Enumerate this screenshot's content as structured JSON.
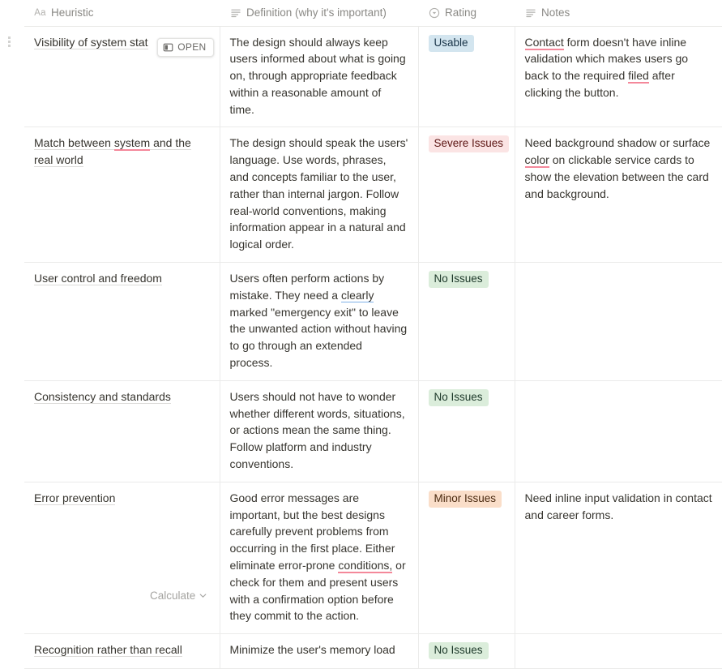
{
  "table": {
    "columns": [
      {
        "id": "heuristic",
        "label": "Heuristic",
        "icon": "title-aa-icon",
        "icon_text": "Aa"
      },
      {
        "id": "definition",
        "label": "Definition (why it's important)",
        "icon": "text-lines-icon",
        "icon_text": ""
      },
      {
        "id": "rating",
        "label": "Rating",
        "icon": "select-circle-chevron-icon",
        "icon_text": ""
      },
      {
        "id": "notes",
        "label": "Notes",
        "icon": "text-lines-icon",
        "icon_text": ""
      }
    ],
    "row_open_button": {
      "label": "OPEN",
      "icon": "expand-panel-icon"
    },
    "footer": {
      "calculate_label": "Calculate",
      "chevron_icon": "chevron-down-icon"
    },
    "colors": {
      "pill_usable_bg": "#d3e5ef",
      "pill_usable_text": "#183347",
      "pill_severe_bg": "#fbe4e4",
      "pill_severe_text": "#5d1715",
      "pill_none_bg": "#dbeddb",
      "pill_none_text": "#1c3829",
      "pill_minor_bg": "#fadec9",
      "pill_minor_text": "#49290f",
      "spellcheck_underline": "#f4889a",
      "grammar_underline": "#7fb0e8",
      "grid_line": "#ebebea",
      "header_text": "#8a8985"
    },
    "rows": [
      {
        "heuristic": "Visibility of system status",
        "heuristic_truncated": "Visibility of system stat",
        "definition": "The design should always keep users informed about what is going on, through appropriate feedback within a reasonable amount of time.",
        "rating": "Usable",
        "rating_style": "usable",
        "notes": "Contact form doesn't have inline validation which makes users go back to the required filed after clicking the button.",
        "notes_spellcheck": [
          "Contact",
          "filed"
        ],
        "has_open_button": true
      },
      {
        "heuristic": "Match between system and the real world",
        "heuristic_spellcheck": [
          "system"
        ],
        "definition": "The design should speak the users' language. Use words, phrases, and concepts familiar to the user, rather than internal jargon. Follow real-world conventions, making information appear in a natural and logical order.",
        "rating": "Severe Issues",
        "rating_style": "severe",
        "notes": "Need background shadow or surface color on clickable service cards to show the elevation between the card and background.",
        "notes_spellcheck": [
          "color"
        ],
        "has_open_button": false
      },
      {
        "heuristic": "User control and freedom",
        "definition": "Users often perform actions by mistake. They need a clearly marked \"emergency exit\" to leave the unwanted action without having to go through an extended process.",
        "definition_grammar": [
          "clearly"
        ],
        "rating": "No Issues",
        "rating_style": "none",
        "notes": "",
        "has_open_button": false
      },
      {
        "heuristic": "Consistency and standards",
        "definition": "Users should not have to wonder whether different words, situations, or actions mean the same thing. Follow platform and industry conventions.",
        "rating": "No Issues",
        "rating_style": "none",
        "notes": "",
        "has_open_button": false
      },
      {
        "heuristic": "Error prevention",
        "definition": "Good error messages are important, but the best designs carefully prevent problems from occurring in the first place. Either eliminate error-prone conditions, or check for them and present users with a confirmation option before they commit to the action.",
        "definition_spellcheck": [
          "conditions,"
        ],
        "rating": "Minor Issues",
        "rating_style": "minor",
        "notes": "Need inline input validation in contact and career forms.",
        "has_open_button": false
      },
      {
        "heuristic": "Recognition rather than recall",
        "definition": "Minimize the user's memory load",
        "rating": "No Issues",
        "rating_style": "none",
        "notes": "",
        "has_open_button": false
      }
    ]
  }
}
